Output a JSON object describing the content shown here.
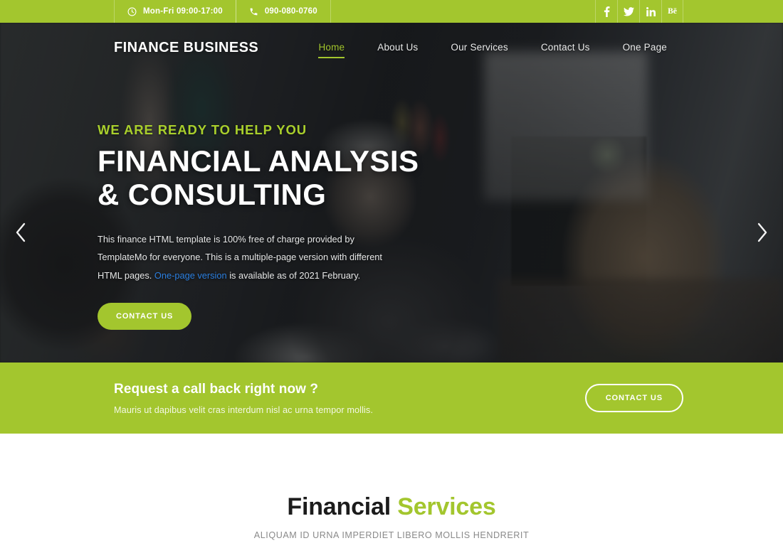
{
  "topbar": {
    "hours": {
      "icon": "clock-icon",
      "text": "Mon-Fri 09:00-17:00"
    },
    "phone": {
      "icon": "phone-icon",
      "text": "090-080-0760"
    },
    "social": [
      {
        "icon": "facebook-icon",
        "label": "f"
      },
      {
        "icon": "twitter-icon",
        "label": "t"
      },
      {
        "icon": "linkedin-icon",
        "label": "in"
      },
      {
        "icon": "behance-icon",
        "label": "Bē"
      }
    ],
    "bg_color": "#a3c62e"
  },
  "nav": {
    "logo": "FINANCE BUSINESS",
    "items": [
      {
        "label": "Home",
        "active": true
      },
      {
        "label": "About Us",
        "active": false
      },
      {
        "label": "Our Services",
        "active": false
      },
      {
        "label": "Contact Us",
        "active": false
      },
      {
        "label": "One Page",
        "active": false
      }
    ],
    "active_color": "#a3c62e"
  },
  "hero": {
    "eyebrow": "WE ARE READY TO HELP YOU",
    "headline_line1": "FINANCIAL ANALYSIS",
    "headline_line2": "& CONSULTING",
    "description_part1": "This finance HTML template is 100% free of charge provided by TemplateMo for everyone. This is a multiple-page version with different HTML pages. ",
    "description_link": "One-page version",
    "description_part2": " is available as of 2021 February.",
    "cta_label": "CONTACT US",
    "prev_arrow": "chevron-left-icon",
    "next_arrow": "chevron-right-icon",
    "link_color": "#2b7fe0"
  },
  "callback": {
    "title": "Request a call back right now ?",
    "subtitle": "Mauris ut dapibus velit cras interdum nisl ac urna tempor mollis.",
    "button_label": "CONTACT US",
    "bg_color": "#a3c62e"
  },
  "services": {
    "title_dark": "Financial",
    "title_highlight": "Services",
    "subtitle": "Aliquam id urna imperdiet libero mollis hendrerit",
    "highlight_color": "#a3c62e"
  }
}
